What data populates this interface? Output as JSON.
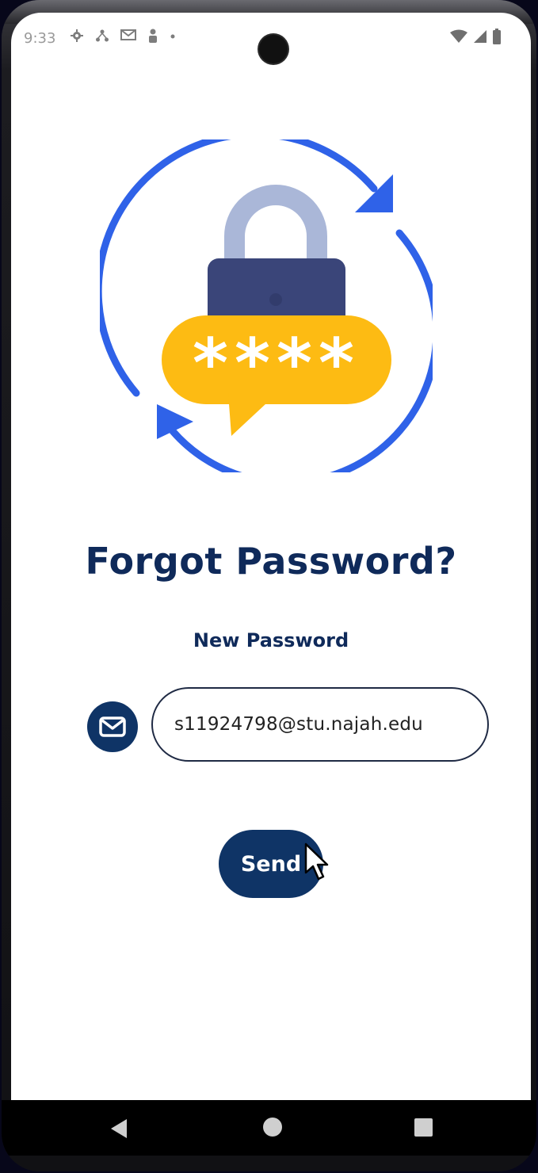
{
  "status_bar": {
    "time": "9:33",
    "left_icons": [
      "settings-icon",
      "network-share-icon",
      "gmail-icon",
      "person-alert-icon",
      "dot-icon"
    ],
    "right_icons": [
      "wifi-icon",
      "signal-icon",
      "battery-icon"
    ]
  },
  "hero": {
    "icon": "password-reset-lock-illustration",
    "password_mask": "****",
    "colors": {
      "arrows": "#2f62e8",
      "shackle": "#aab7d8",
      "lock_body": "#3a4579",
      "bubble": "#fdbb13"
    }
  },
  "page": {
    "title": "Forgot Password?",
    "subtitle": "New Password"
  },
  "form": {
    "email_icon": "mail-icon",
    "email_value": "s11924798@stu.najah.edu",
    "send_label": "Send"
  },
  "nav_bar": {
    "back_icon": "back-triangle-icon",
    "home_icon": "home-circle-icon",
    "recents_icon": "recents-square-icon"
  },
  "colors": {
    "primary": "#0f3466",
    "title_text": "#0f2a5a",
    "background": "#ffffff"
  }
}
